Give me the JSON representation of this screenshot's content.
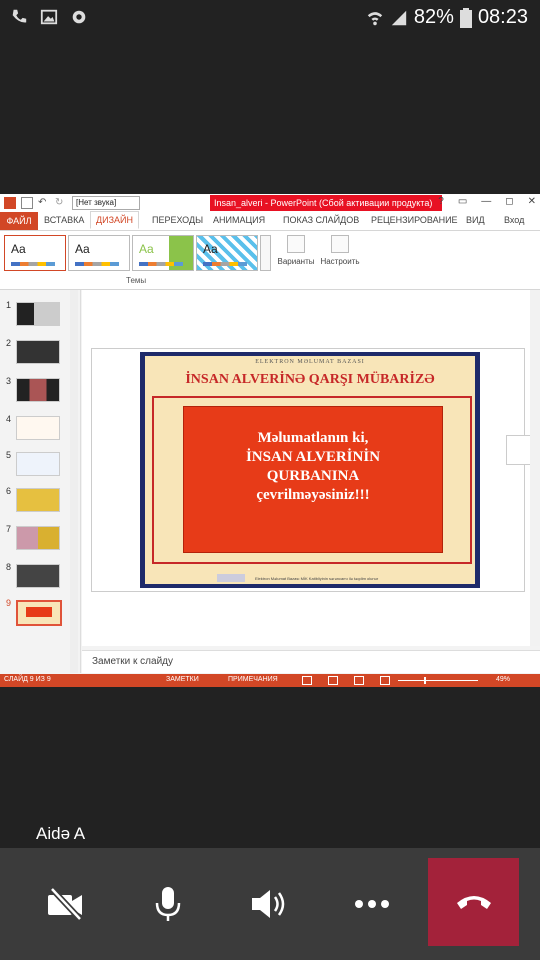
{
  "status_bar": {
    "battery": "82%",
    "time": "08:23",
    "icons": [
      "phone-icon",
      "gallery-icon",
      "settings-icon",
      "wifi-icon",
      "signal-icon",
      "battery-icon"
    ]
  },
  "powerpoint": {
    "window_title": "Insan_alveri - PowerPoint (Сбой активации продукта)",
    "style_select": "[Нет звука]",
    "window_buttons": [
      "?",
      "▭",
      "—",
      "◻",
      "✕"
    ],
    "tabs": [
      "ФАЙЛ",
      "ВСТАВКА",
      "ДИЗАЙН",
      "ПЕРЕХОДЫ",
      "АНИМАЦИЯ",
      "ПОКАЗ СЛАЙДОВ",
      "РЕЦЕНЗИРОВАНИЕ",
      "ВИД",
      "Вход"
    ],
    "themes_label": "Темы",
    "variants_label": "Варианты",
    "customize_label": "Настроить",
    "slides": [
      "1",
      "2",
      "3",
      "4",
      "5",
      "6",
      "7",
      "8",
      "9"
    ],
    "active_slide": "9",
    "notes_placeholder": "Заметки к слайду",
    "status": {
      "slide_counter": "СЛАЙД 9 ИЗ 9",
      "notes": "ЗАМЕТКИ",
      "comments": "ПРИМЕЧАНИЯ",
      "zoom": "49%"
    },
    "accent_color": "#d24726"
  },
  "slide": {
    "top_text": "ELEKTRON MƏLUMAT BAZASI",
    "title": "İNSAN ALVERİNƏ QARŞI MÜBARİZƏ",
    "message_line1": "Məlumatlanın ki,",
    "message_line2": "İNSAN ALVERİNİN",
    "message_line3": "QURBANINA",
    "message_line4": "çevrilməyəsiniz!!!",
    "footer": "Elektron Məlumat Bazası MİK Katibliyinin sərəncamı ilə təqdim olunur"
  },
  "call": {
    "caller_name": "Aidə A",
    "controls": [
      "video-off-icon",
      "microphone-icon",
      "speaker-icon",
      "more-icon",
      "end-call-icon"
    ],
    "end_call_color": "#a3223a"
  }
}
